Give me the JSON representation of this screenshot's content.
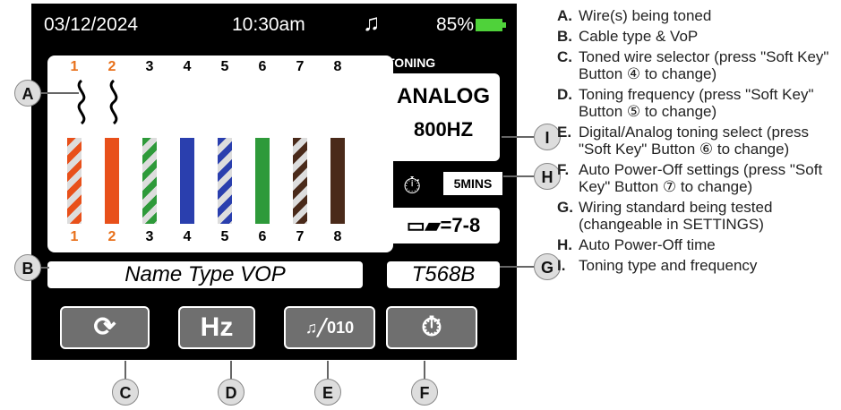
{
  "status": {
    "date": "03/12/2024",
    "time": "10:30am",
    "battery": "85%"
  },
  "pins_top": [
    "1",
    "2",
    "3",
    "4",
    "5",
    "6",
    "7",
    "8"
  ],
  "pins_bottom": [
    "1",
    "2",
    "3",
    "4",
    "5",
    "6",
    "7",
    "8"
  ],
  "toning": {
    "label": "TONING",
    "type": "ANALOG",
    "freq": "800HZ"
  },
  "autooff": {
    "time": "5MINS"
  },
  "pair": {
    "text": "=7-8"
  },
  "cable": {
    "name": "Name Type VOP"
  },
  "standard": {
    "value": "T568B"
  },
  "softkeys": {
    "hz": "Hz",
    "digital": "010"
  },
  "callouts": {
    "A": "A",
    "B": "B",
    "C": "C",
    "D": "D",
    "E": "E",
    "F": "F",
    "G": "G",
    "H": "H",
    "I": "I"
  },
  "legend": [
    {
      "letter": "A.",
      "text": "Wire(s) being toned"
    },
    {
      "letter": "B.",
      "text": "Cable type & VoP"
    },
    {
      "letter": "C.",
      "text": "Toned wire selector (press \"Soft Key\" Button ④ to change)"
    },
    {
      "letter": "D.",
      "text": "Toning frequency (press \"Soft Key\" Button ⑤ to change)"
    },
    {
      "letter": "E.",
      "text": "Digital/Analog toning select (press \"Soft Key\" Button ⑥ to change)"
    },
    {
      "letter": "F.",
      "text": "Auto Power-Off settings (press \"Soft Key\" Button ⑦ to change)"
    },
    {
      "letter": "G.",
      "text": "Wiring standard being tested (changeable in SETTINGS)"
    },
    {
      "letter": "H.",
      "text": "Auto Power-Off time"
    },
    {
      "letter": "I.",
      "text": "Toning type and frequency"
    }
  ]
}
